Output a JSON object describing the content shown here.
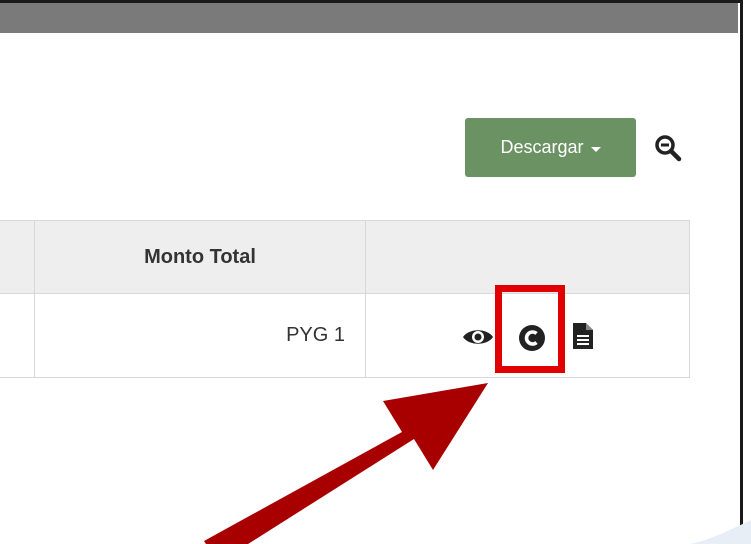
{
  "toolbar": {
    "download_label": "Descargar",
    "download_caret_icon": "caret-down-icon",
    "zoom_icon": "zoom-out-icon"
  },
  "table": {
    "columns": [
      "",
      "Monto Total",
      ""
    ],
    "rows": [
      {
        "amount": "PYG 1",
        "actions": [
          "eye-icon",
          "cancel-c-icon",
          "document-icon"
        ]
      }
    ]
  },
  "annotation": {
    "highlight_color": "#e00000",
    "arrow_color": "#a80000"
  },
  "colors": {
    "topbar": "#7a7a7a",
    "download_button": "#6b9262",
    "header_bg": "#eeeeee",
    "border": "#d8d8d8"
  }
}
